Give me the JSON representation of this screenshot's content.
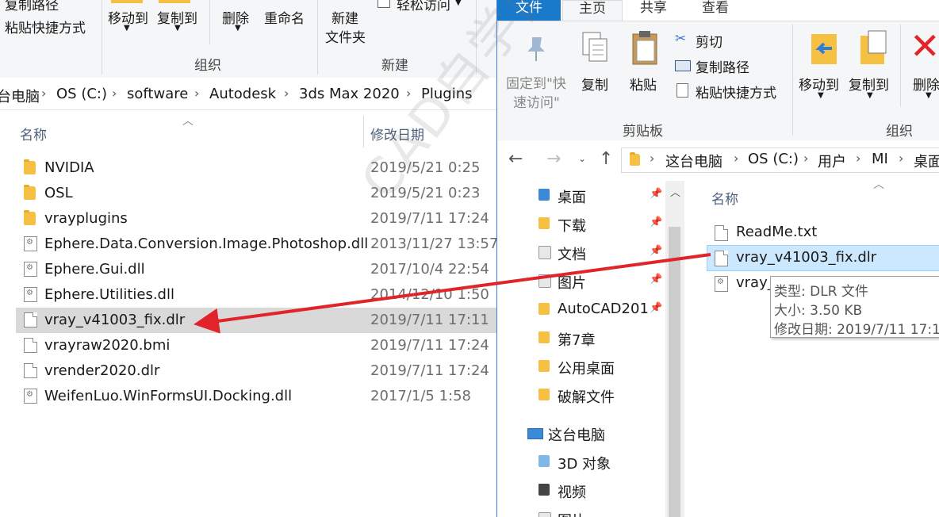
{
  "left_window": {
    "ribbon": {
      "copy_path_label": "复制路径",
      "paste_shortcut_label": "粘贴快捷方式",
      "move_to_label": "移动到",
      "copy_to_label": "复制到",
      "delete_label": "删除",
      "rename_label": "重命名",
      "new_folder_label_line1": "新建",
      "new_folder_label_line2": "文件夹",
      "easy_access_label": "轻松访问",
      "group_organize": "组织",
      "group_new": "新建"
    },
    "breadcrumb": [
      "台电脑",
      "OS (C:)",
      "software",
      "Autodesk",
      "3ds Max 2020",
      "Plugins"
    ],
    "columns": {
      "name": "名称",
      "date": "修改日期"
    },
    "files": [
      {
        "icon": "folder-icon",
        "name": "NVIDIA",
        "date": "2019/5/21 0:25"
      },
      {
        "icon": "folder-icon",
        "name": "OSL",
        "date": "2019/5/21 0:23"
      },
      {
        "icon": "folder-icon",
        "name": "vrayplugins",
        "date": "2019/7/11 17:24"
      },
      {
        "icon": "dll-file-icon",
        "name": "Ephere.Data.Conversion.Image.Photoshop.dll",
        "date": "2013/11/27 13:57"
      },
      {
        "icon": "dll-file-icon",
        "name": "Ephere.Gui.dll",
        "date": "2017/10/4 22:54"
      },
      {
        "icon": "dll-file-icon",
        "name": "Ephere.Utilities.dll",
        "date": "2014/12/10 1:50"
      },
      {
        "icon": "file-icon",
        "name": "vray_v41003_fix.dlr",
        "date": "2019/7/11 17:11",
        "selected": true
      },
      {
        "icon": "file-icon",
        "name": "vrayraw2020.bmi",
        "date": "2019/7/11 17:24"
      },
      {
        "icon": "file-icon",
        "name": "vrender2020.dlr",
        "date": "2019/7/11 17:24"
      },
      {
        "icon": "dll-file-icon",
        "name": "WeifenLuo.WinFormsUI.Docking.dll",
        "date": "2017/1/5 1:58"
      }
    ]
  },
  "right_window": {
    "tabs": [
      "文件",
      "主页",
      "共享",
      "查看"
    ],
    "ribbon": {
      "pin_quick_access_line1": "固定到\"快",
      "pin_quick_access_line2": "速访问\"",
      "copy_label": "复制",
      "paste_label": "粘贴",
      "cut_label": "剪切",
      "copy_path_label": "复制路径",
      "paste_shortcut_label": "粘贴快捷方式",
      "move_to_label": "移动到",
      "copy_to_label": "复制到",
      "delete_label": "删除",
      "group_clipboard": "剪贴板",
      "group_organize": "组织"
    },
    "breadcrumb": [
      "这台电脑",
      "OS (C:)",
      "用户",
      "MI",
      "桌面"
    ],
    "nav_pane": [
      {
        "label": "桌面",
        "pinned": true
      },
      {
        "label": "下载",
        "pinned": true
      },
      {
        "label": "文档",
        "pinned": true
      },
      {
        "label": "图片",
        "pinned": true
      },
      {
        "label": "AutoCAD201",
        "pinned": true
      },
      {
        "label": "第7章",
        "pinned": false
      },
      {
        "label": "公用桌面",
        "pinned": false
      },
      {
        "label": "破解文件",
        "pinned": false
      },
      {
        "label": "这台电脑",
        "pinned": false
      },
      {
        "label": "3D 对象",
        "pinned": false
      },
      {
        "label": "视频",
        "pinned": false
      },
      {
        "label": "图片",
        "pinned": false
      }
    ],
    "column_name": "名称",
    "files": [
      {
        "name": "ReadMe.txt"
      },
      {
        "name": "vray_v41003_fix.dlr",
        "selected": true
      },
      {
        "name": "vray_"
      }
    ],
    "tooltip": {
      "type": "类型: DLR 文件",
      "size": "大小: 3.50 KB",
      "modified": "修改日期: 2019/7/11 17:1"
    }
  },
  "arrow_color": "#e0242a",
  "watermark_text": "CAD自学网 www.cadzxw.com"
}
